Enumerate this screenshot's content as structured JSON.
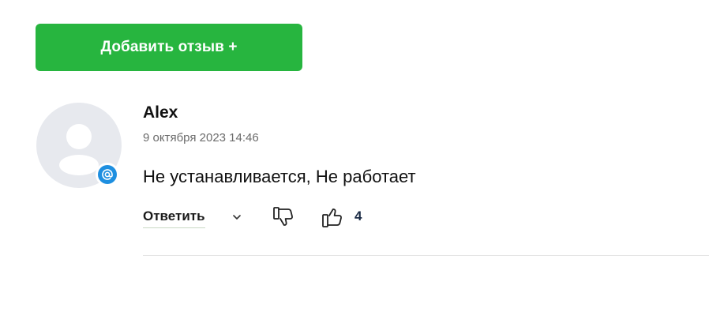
{
  "actions": {
    "add_review_label": "Добавить отзыв +"
  },
  "review": {
    "author": "Alex",
    "date": "9 октября 2023 14:46",
    "text": "Не устанавливается, Не работает",
    "reply_label": "Ответить",
    "like_count": "4",
    "avatar_badge_icon": "at-sign-icon",
    "avatar_icon": "user-placeholder-icon"
  },
  "colors": {
    "accent_green": "#27b53f",
    "badge_blue": "#1e8fe0",
    "avatar_bg": "#e7e9ee"
  }
}
